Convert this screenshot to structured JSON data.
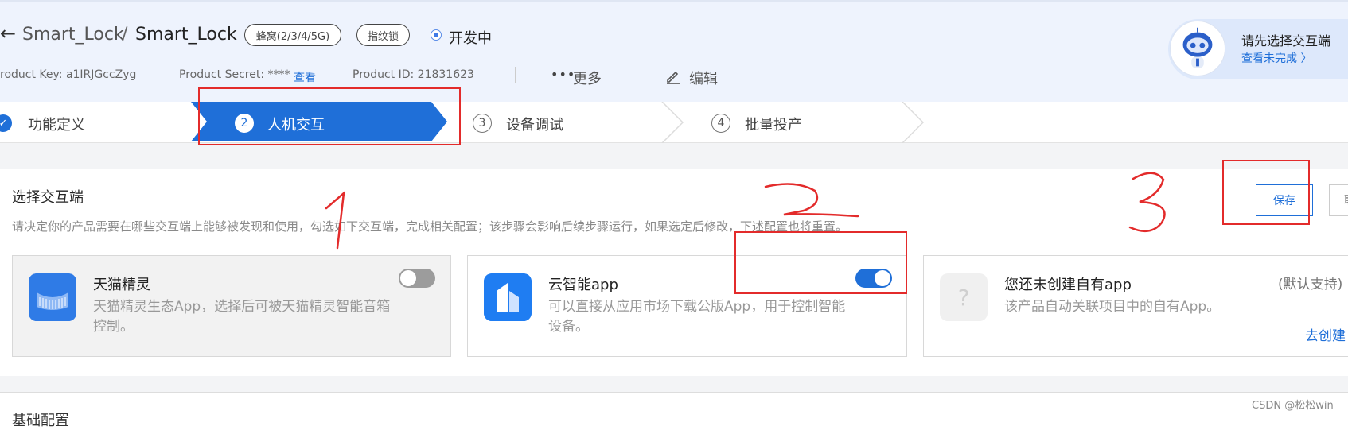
{
  "header": {
    "back_icon": "arrow-left-icon",
    "crumb_parent": "Smart_Lock",
    "crumb_separator": "/",
    "crumb_current": "Smart_Lock",
    "tags": [
      "蜂窝(2/3/4/5G)",
      "指纹锁"
    ],
    "status": "开发中",
    "product_key_text": "roduct Key:  a1IRJGccZyg",
    "product_secret_text": "Product Secret:  ****",
    "view_link": "查看",
    "product_id_text": "Product ID:  21831623",
    "more_label": "更多",
    "edit_label": "编辑"
  },
  "assistant": {
    "title": "请先选择交互端",
    "link": "查看未完成 〉"
  },
  "steps": [
    {
      "label": "功能定义",
      "num": "✓"
    },
    {
      "label": "人机交互",
      "num": "2"
    },
    {
      "label": "设备调试",
      "num": "3"
    },
    {
      "label": "批量投产",
      "num": "4"
    }
  ],
  "section": {
    "title": "选择交互端",
    "desc": "请决定你的产品需要在哪些交互端上能够被发现和使用，勾选如下交互端，完成相关配置；该步骤会影响后续步骤运行，如果选定后修改，下述配置也将重置。",
    "save_label": "保存",
    "cancel_label": "取"
  },
  "cards": [
    {
      "title": "天猫精灵",
      "desc": "天猫精灵生态App，选择后可被天猫精灵智能音箱控制。",
      "enabled": false,
      "icon": "tmall-genie-icon"
    },
    {
      "title": "云智能app",
      "desc": "可以直接从应用市场下载公版App，用于控制智能设备。",
      "enabled": true,
      "icon": "cloud-home-icon"
    },
    {
      "title": "您还未创建自有app",
      "desc": "该产品自动关联项目中的自有App。",
      "default_text": "(默认支持)",
      "create_link": "去创建",
      "icon": "question-icon",
      "icon_glyph": "?"
    }
  ],
  "footer": {
    "base_config": "基础配置",
    "watermark": "CSDN @松松win"
  },
  "colors": {
    "accent": "#1f6fd8",
    "annotation": "#e32b2b",
    "header_bg": "#eef3fd"
  }
}
